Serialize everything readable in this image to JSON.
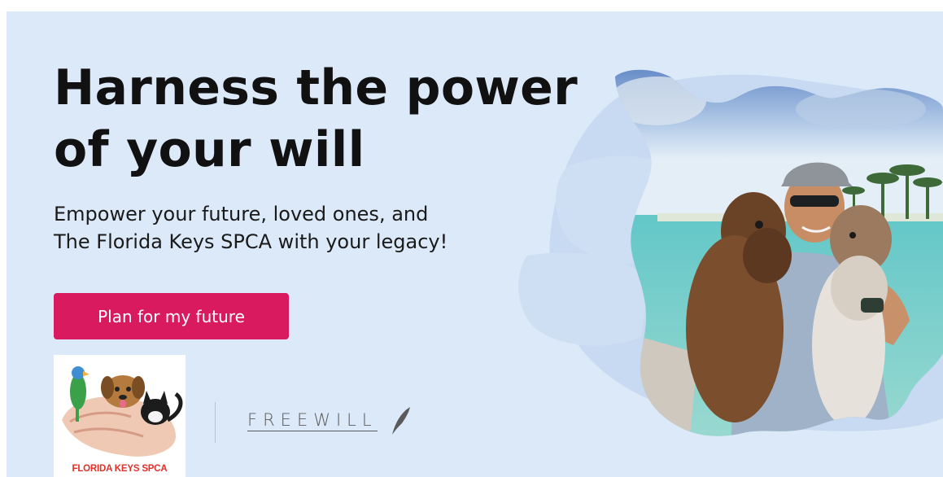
{
  "banner": {
    "headline_line1": "Harness the power",
    "headline_line2": "of your will",
    "subtext_line1": "Empower your future, loved ones, and",
    "subtext_line2": "The Florida Keys SPCA with your legacy!",
    "cta_label": "Plan for my future"
  },
  "logos": {
    "org_name": "FLORIDA KEYS SPCA",
    "partner_name": "FREEWILL"
  },
  "colors": {
    "background": "#dce9f9",
    "cta": "#d91a5f",
    "headline": "#111111"
  },
  "photo": {
    "subject": "person in cap and sunglasses holding two curly-haired dogs by the sea"
  }
}
